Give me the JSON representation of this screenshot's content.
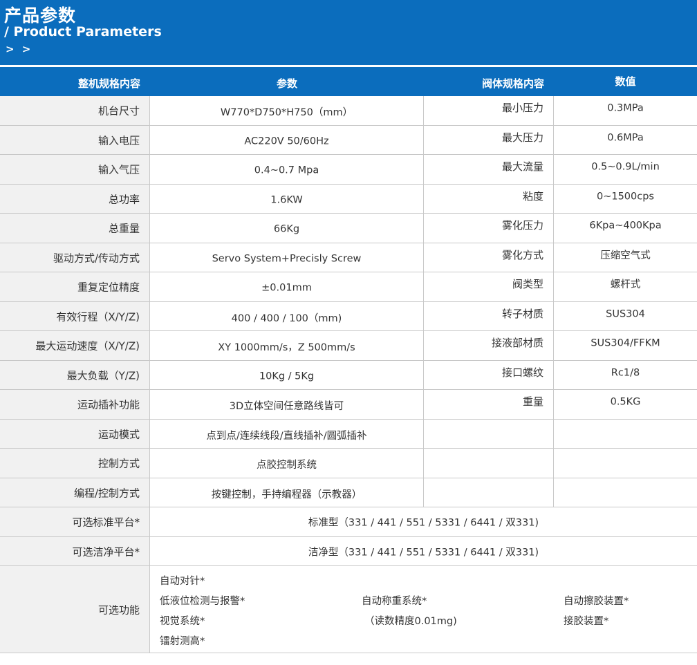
{
  "header": {
    "title_cn": "产品参数",
    "title_en": "/ Product Parameters",
    "arrows": "> >"
  },
  "columns": [
    "整机规格内容",
    "参数",
    "阀体规格内容",
    "数值"
  ],
  "rows": [
    {
      "name": "机台尺寸",
      "value": "W770*D750*H750（mm）",
      "valve_name": "最小压力",
      "valve_value": "0.3MPa"
    },
    {
      "name": "输入电压",
      "value": "AC220V 50/60Hz",
      "valve_name": "最大压力",
      "valve_value": "0.6MPa"
    },
    {
      "name": "输入气压",
      "value": "0.4~0.7 Mpa",
      "valve_name": "最大流量",
      "valve_value": "0.5~0.9L/min"
    },
    {
      "name": "总功率",
      "value": "1.6KW",
      "valve_name": "粘度",
      "valve_value": "0~1500cps"
    },
    {
      "name": "总重量",
      "value": "66Kg",
      "valve_name": "雾化压力",
      "valve_value": "6Kpa~400Kpa"
    },
    {
      "name": "驱动方式/传动方式",
      "value": "Servo System+Precisly  Screw",
      "valve_name": "雾化方式",
      "valve_value": "压缩空气式"
    },
    {
      "name": "重复定位精度",
      "value": "±0.01mm",
      "valve_name": "阀类型",
      "valve_value": "螺杆式"
    },
    {
      "name": "有效行程（X/Y/Z)",
      "value": "400 / 400 / 100（mm)",
      "valve_name": "转子材质",
      "valve_value": "SUS304"
    },
    {
      "name": "最大运动速度（X/Y/Z)",
      "value": "XY 1000mm/s，Z 500mm/s",
      "valve_name": "接液部材质",
      "valve_value": "SUS304/FFKM"
    },
    {
      "name": "最大负载（Y/Z)",
      "value": "10Kg / 5Kg",
      "valve_name": "接口螺纹",
      "valve_value": "Rc1/8"
    },
    {
      "name": "运动插补功能",
      "value": "3D立体空间任意路线皆可",
      "valve_name": "重量",
      "valve_value": "0.5KG"
    },
    {
      "name": "运动模式",
      "value": "点到点/连续线段/直线插补/圆弧插补",
      "valve_name": "",
      "valve_value": ""
    },
    {
      "name": "控制方式",
      "value": "点胶控制系统",
      "valve_name": "",
      "valve_value": ""
    },
    {
      "name": "编程/控制方式",
      "value": "按键控制，手持编程器（示教器）",
      "valve_name": "",
      "valve_value": ""
    }
  ],
  "wide_rows": [
    {
      "name": "可选标准平台*",
      "value": "标准型（331 / 441 / 551 / 5331 / 6441 / 双331)"
    },
    {
      "name": "可选洁净平台*",
      "value": "洁净型（331 / 441 / 551 / 5331 / 6441 / 双331)"
    }
  ],
  "optional": {
    "name": "可选功能",
    "col1": [
      "自动对针*",
      "低液位检测与报警*",
      "视觉系统*",
      "镭射测高*"
    ],
    "col2": [
      "自动称重系统*",
      "（读数精度0.01mg)"
    ],
    "col3": [
      "自动擦胶装置*",
      "接胶装置*"
    ]
  }
}
